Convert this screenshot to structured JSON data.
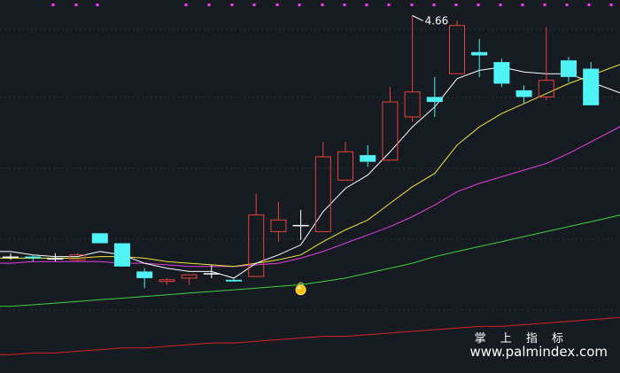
{
  "chart_data": {
    "type": "candlestick",
    "peak_label": "4.66",
    "ylim": [
      2.6,
      4.7
    ],
    "grid": true,
    "colors": {
      "background": "#161a21",
      "grid": "#2b3340",
      "up": "#e8423c",
      "down": "#4ff3f5",
      "flat": "#ffffff",
      "ma_fast": "#ffffff",
      "ma_mid": "#f1e53c",
      "ma_long": "#e13fe3",
      "ma_longer": "#3cd23c",
      "ma_longest": "#d62222",
      "top_markers": "#ff38ff",
      "signal": "#f7c300"
    },
    "candles": [
      {
        "o": 3.21,
        "h": 3.23,
        "l": 3.19,
        "c": 3.21
      },
      {
        "o": 3.21,
        "h": 3.22,
        "l": 3.18,
        "c": 3.2
      },
      {
        "o": 3.2,
        "h": 3.23,
        "l": 3.18,
        "c": 3.2
      },
      {
        "o": 3.19,
        "h": 3.23,
        "l": 3.18,
        "c": 3.22
      },
      {
        "o": 3.35,
        "h": 3.35,
        "l": 3.29,
        "c": 3.29
      },
      {
        "o": 3.29,
        "h": 3.29,
        "l": 3.15,
        "c": 3.15
      },
      {
        "o": 3.12,
        "h": 3.14,
        "l": 3.02,
        "c": 3.08
      },
      {
        "o": 3.06,
        "h": 3.08,
        "l": 3.04,
        "c": 3.07
      },
      {
        "o": 3.08,
        "h": 3.1,
        "l": 3.04,
        "c": 3.1
      },
      {
        "o": 3.11,
        "h": 3.16,
        "l": 3.08,
        "c": 3.11
      },
      {
        "o": 3.07,
        "h": 3.08,
        "l": 3.06,
        "c": 3.06
      },
      {
        "o": 3.09,
        "h": 3.59,
        "l": 3.09,
        "c": 3.46
      },
      {
        "o": 3.36,
        "h": 3.54,
        "l": 3.3,
        "c": 3.43
      },
      {
        "o": 3.4,
        "h": 3.49,
        "l": 3.31,
        "c": 3.4
      },
      {
        "o": 3.36,
        "h": 3.9,
        "l": 3.36,
        "c": 3.81
      },
      {
        "o": 3.67,
        "h": 3.9,
        "l": 3.67,
        "c": 3.84
      },
      {
        "o": 3.82,
        "h": 3.88,
        "l": 3.75,
        "c": 3.78
      },
      {
        "o": 3.79,
        "h": 4.23,
        "l": 3.79,
        "c": 4.14
      },
      {
        "o": 4.05,
        "h": 4.66,
        "l": 4.02,
        "c": 4.2
      },
      {
        "o": 4.17,
        "h": 4.29,
        "l": 4.05,
        "c": 4.14
      },
      {
        "o": 4.31,
        "h": 4.63,
        "l": 4.31,
        "c": 4.6
      },
      {
        "o": 4.44,
        "h": 4.52,
        "l": 4.29,
        "c": 4.42
      },
      {
        "o": 4.38,
        "h": 4.4,
        "l": 4.23,
        "c": 4.25
      },
      {
        "o": 4.21,
        "h": 4.24,
        "l": 4.13,
        "c": 4.17
      },
      {
        "o": 4.17,
        "h": 4.59,
        "l": 4.15,
        "c": 4.27
      },
      {
        "o": 4.39,
        "h": 4.41,
        "l": 4.26,
        "c": 4.29
      },
      {
        "o": 4.34,
        "h": 4.38,
        "l": 4.12,
        "c": 4.12
      }
    ],
    "ma_fast": [
      3.24,
      3.22,
      3.21,
      3.21,
      3.24,
      3.22,
      3.17,
      3.14,
      3.12,
      3.12,
      3.08,
      3.17,
      3.22,
      3.28,
      3.48,
      3.62,
      3.7,
      3.84,
      3.99,
      4.11,
      4.28,
      4.33,
      4.35,
      4.32,
      4.31,
      4.31,
      4.26
    ],
    "ma_mid": [
      3.2,
      3.2,
      3.2,
      3.2,
      3.21,
      3.21,
      3.2,
      3.18,
      3.17,
      3.16,
      3.15,
      3.17,
      3.19,
      3.22,
      3.3,
      3.37,
      3.43,
      3.53,
      3.63,
      3.71,
      3.88,
      3.99,
      4.07,
      4.13,
      4.19,
      4.25,
      4.3
    ],
    "ma_long": [
      3.17,
      3.18,
      3.18,
      3.18,
      3.18,
      3.17,
      3.17,
      3.16,
      3.15,
      3.15,
      3.15,
      3.16,
      3.17,
      3.2,
      3.24,
      3.29,
      3.34,
      3.39,
      3.45,
      3.52,
      3.6,
      3.65,
      3.69,
      3.73,
      3.77,
      3.83,
      3.9
    ],
    "ma_longer": [
      2.91,
      2.92,
      2.93,
      2.94,
      2.95,
      2.96,
      2.97,
      2.98,
      2.99,
      3.0,
      3.01,
      3.02,
      3.03,
      3.04,
      3.06,
      3.08,
      3.11,
      3.14,
      3.17,
      3.21,
      3.24,
      3.27,
      3.3,
      3.33,
      3.36,
      3.39,
      3.42
    ],
    "ma_longest": [
      2.62,
      2.63,
      2.63,
      2.64,
      2.65,
      2.66,
      2.66,
      2.67,
      2.68,
      2.69,
      2.69,
      2.7,
      2.71,
      2.72,
      2.73,
      2.73,
      2.74,
      2.75,
      2.76,
      2.77,
      2.78,
      2.79,
      2.79,
      2.8,
      2.81,
      2.82,
      2.83
    ],
    "signal_candle_index": 13,
    "signal_value": 3.01
  },
  "watermark": {
    "line1": "掌 上 指 标",
    "line2": "www.palmindex.com"
  }
}
